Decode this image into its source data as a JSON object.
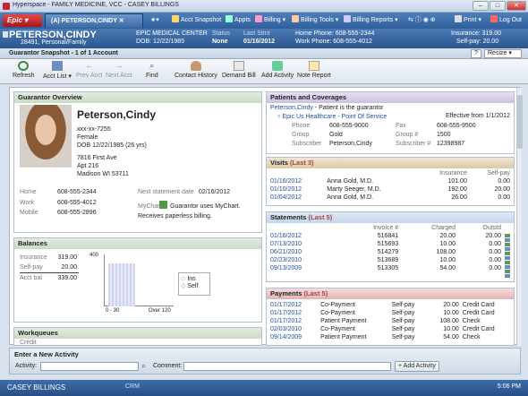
{
  "window": {
    "title": "Hyperspace - FAMILY MEDICINE, VCC - CASEY BILLINGS",
    "min": "–",
    "max": "□",
    "close": "✕"
  },
  "toolbar": {
    "epic": "Epic",
    "patient_tab": "(A) PETERSON,CINDY",
    "snapshot": "Acct Snapshot",
    "appts": "Appts",
    "billing": "Billing",
    "billing_tools": "Billing Tools",
    "billing_reports": "Billing Reports",
    "print": "Print",
    "logout": "Log Out"
  },
  "header": {
    "name": "PETERSON,CINDY",
    "sub": "28491, Personal/Family",
    "center": "EPIC MEDICAL CENTER",
    "dob": "DOB: 12/22/1985",
    "status_label": "Status",
    "status": "None",
    "last_stmt_label": "Last Stmt",
    "last_stmt": "01/16/2012",
    "home_phone": "Home Phone: 608-555-2344",
    "work_phone": "Work Phone: 608-555-4012",
    "insurance": "Insurance: 319.00",
    "selfpay": "Self-pay: 20.00"
  },
  "snapbar": {
    "title": "Guarantor Snapshot - 1 of 1 Account",
    "help": "?",
    "resize": "Resize"
  },
  "actions": [
    {
      "label": "Refresh"
    },
    {
      "label": "Acct List"
    },
    {
      "label": "Prev Acct"
    },
    {
      "label": "Next Acct"
    },
    {
      "label": "Find"
    },
    {
      "label": "Contact History"
    },
    {
      "label": "Demand Bill"
    },
    {
      "label": "Add Activity"
    },
    {
      "label": "Note Report"
    }
  ],
  "overview": {
    "title": "Guarantor Overview",
    "name": "Peterson,Cindy",
    "ssn": "xxx-xx-7255",
    "sex": "Female",
    "dob": "DOB 12/22/1985 (26 yrs)",
    "addr1": "7816 First Ave",
    "addr2": "Apt 216",
    "addr3": "Madison WI 53711",
    "home_label": "Home",
    "home": "608-555-2344",
    "work_label": "Work",
    "work": "608-555-4012",
    "mobile_label": "Mobile",
    "mobile": "608-555-2896",
    "next_label": "Next statement date",
    "next": "02/16/2012",
    "mychart_label": "MyChart",
    "mychart": "Guarantor uses MyChart.",
    "paperless": "Receives paperless billing."
  },
  "balances": {
    "title": "Balances",
    "ins_label": "Insurance",
    "ins": "319.00",
    "self_label": "Self-pay",
    "self": "20.00",
    "acct_label": "Acct bal",
    "acct": "339.00",
    "chart_ymax": "400",
    "x0": "0 - 30",
    "x1": "Over 120",
    "legend_ins": "Ins",
    "legend_self": "Self"
  },
  "workqueues": {
    "title": "Workqueues",
    "sub": "Credit"
  },
  "coverages": {
    "title": "Patients and Coverages",
    "patient": "Peterson,Cindy",
    "patient_note": " - Patient is the guarantor",
    "plan": "Epic Us Healthcare - Point Of Service",
    "effective": "Effective from 1/1/2012",
    "phone_label": "Phone",
    "phone": "608-555-9000",
    "fax_label": "Fax",
    "fax": "608-555-9500",
    "group_label": "Group",
    "group": "Gold",
    "groupno_label": "Group #",
    "groupno": "1500",
    "sub_label": "Subscriber",
    "sub": "Peterson,Cindy",
    "subno_label": "Subscriber #",
    "subno": "12398987"
  },
  "visits": {
    "title": "Visits",
    "count": "(Last 3)",
    "headers": [
      "Insurance",
      "Self-pay"
    ],
    "rows": [
      [
        "01/16/2012",
        "Anna Gold, M.D.",
        "101.00",
        "0.00"
      ],
      [
        "01/10/2012",
        "Marty Seeger, M.D.",
        "192.00",
        "20.00"
      ],
      [
        "01/04/2012",
        "Anna Gold, M.D.",
        "26.00",
        "0.00"
      ]
    ]
  },
  "statements": {
    "title": "Statements",
    "count": "(Last 5)",
    "headers": [
      "Invoice #",
      "Charged",
      "Outstd"
    ],
    "rows": [
      [
        "01/16/2012",
        "516841",
        "20.00",
        "20.00"
      ],
      [
        "07/13/2010",
        "515693",
        "10.00",
        "0.00"
      ],
      [
        "06/21/2010",
        "514279",
        "108.00",
        "0.00"
      ],
      [
        "02/23/2010",
        "513689",
        "10.00",
        "0.00"
      ],
      [
        "09/13/2009",
        "513305",
        "54.00",
        "0.00"
      ]
    ]
  },
  "payments": {
    "title": "Payments",
    "count": "(Last 5)",
    "rows": [
      [
        "01/17/2012",
        "Co-Payment",
        "Self-pay",
        "20.00",
        "Credit Card"
      ],
      [
        "01/17/2012",
        "Co-Payment",
        "Self-pay",
        "10.00",
        "Credit Card"
      ],
      [
        "01/17/2012",
        "Patient Payment",
        "Self-pay",
        "108.00",
        "Check"
      ],
      [
        "02/03/2010",
        "Co-Payment",
        "Self-pay",
        "10.00",
        "Credit Card"
      ],
      [
        "09/14/2009",
        "Patient Payment",
        "Self-pay",
        "54.00",
        "Check"
      ]
    ]
  },
  "newactivity": {
    "title": "Enter a New Activity",
    "activity_label": "Activity:",
    "comment_label": "Comment:",
    "add": "Add Activity"
  },
  "status": {
    "user": "CASEY BILLINGS",
    "crm": "CRM",
    "time": "5:06 PM"
  },
  "colors": {
    "accent": "#2f5f9c",
    "link": "#1e4e9c"
  }
}
